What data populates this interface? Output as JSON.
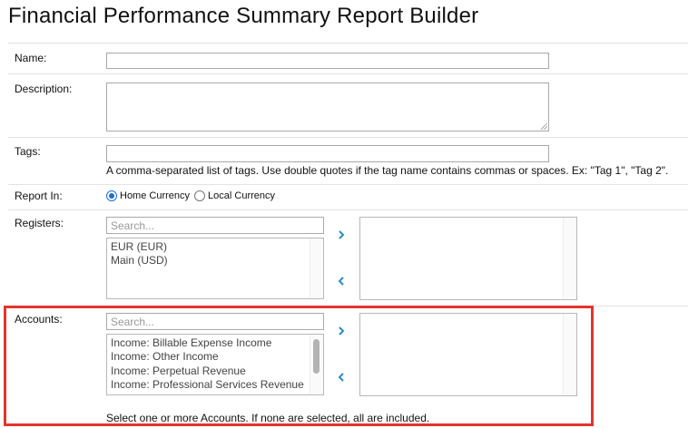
{
  "title": "Financial Performance Summary Report Builder",
  "fields": {
    "name": {
      "label": "Name:",
      "value": ""
    },
    "description": {
      "label": "Description:",
      "value": ""
    },
    "tags": {
      "label": "Tags:",
      "value": "",
      "hint": "A comma-separated list of tags. Use double quotes if the tag name contains commas or spaces. Ex: \"Tag 1\", \"Tag 2\"."
    },
    "report_in": {
      "label": "Report In:",
      "options": [
        {
          "label": "Home Currency",
          "selected": true
        },
        {
          "label": "Local Currency",
          "selected": false
        }
      ]
    },
    "registers": {
      "label": "Registers:",
      "search_placeholder": "Search...",
      "available": [
        "EUR (EUR)",
        "Main (USD)"
      ],
      "selected": []
    },
    "accounts": {
      "label": "Accounts:",
      "search_placeholder": "Search...",
      "available": [
        "Income: Billable Expense Income",
        "Income: Other Income",
        "Income: Perpetual Revenue",
        "Income: Professional Services Revenue"
      ],
      "selected": [],
      "hint": "Select one or more Accounts. If none are selected, all are included."
    }
  },
  "icons": {
    "add": "chevron-right-icon",
    "remove": "chevron-left-icon"
  },
  "colors": {
    "arrow": "#2a8cc4",
    "highlight": "#e2352c",
    "radio_checked": "#1a6fd6"
  }
}
